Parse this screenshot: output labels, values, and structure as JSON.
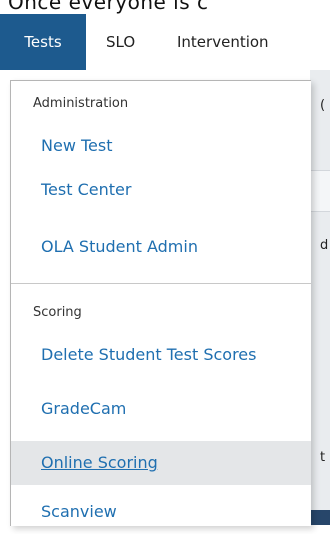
{
  "top_fragment": "Once everyone is c",
  "nav": {
    "tabs": [
      {
        "label": "Tests",
        "active": true
      },
      {
        "label": "SLO",
        "active": false
      },
      {
        "label": "Intervention",
        "active": false
      }
    ]
  },
  "background_fragments": [
    "(",
    "d",
    "t"
  ],
  "dropdown": {
    "sections": [
      {
        "header": "Administration",
        "items": [
          "New Test",
          "Test Center",
          "OLA Student Admin"
        ]
      },
      {
        "header": "Scoring",
        "items": [
          "Delete Student Test Scores",
          "GradeCam",
          "Online Scoring",
          "Scanview"
        ]
      }
    ],
    "highlighted_item": "Online Scoring"
  },
  "colors": {
    "active_tab_bg": "#1d5a8e",
    "link": "#1f6fb0",
    "hover_bg": "#e4e6e8"
  }
}
